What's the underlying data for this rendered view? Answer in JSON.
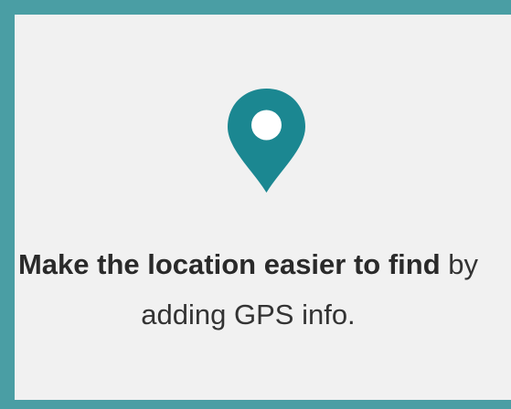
{
  "card": {
    "icon": "location-pin-icon",
    "accent_color": "#1b8791",
    "border_color": "#4a9ea4",
    "background_color": "#f1f1f1",
    "message_bold": "Make the location easier to find",
    "message_rest_line1": " by",
    "message_line2": "adding GPS info."
  }
}
